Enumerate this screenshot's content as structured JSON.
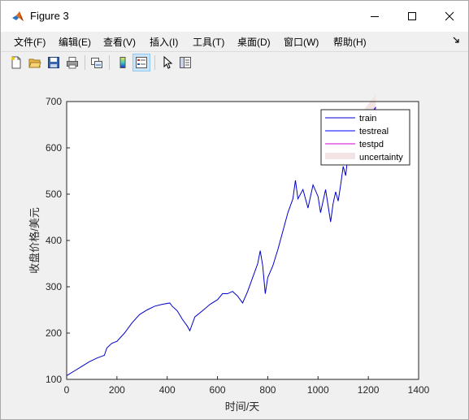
{
  "window": {
    "title": "Figure 3"
  },
  "menu": [
    "文件(F)",
    "编辑(E)",
    "查看(V)",
    "插入(I)",
    "工具(T)",
    "桌面(D)",
    "窗口(W)",
    "帮助(H)"
  ],
  "toolbar": {
    "icons": [
      "new-figure-icon",
      "open-file-icon",
      "save-icon",
      "print-icon",
      "link-plot-icon",
      "colorbar-icon",
      "legend-icon",
      "pointer-icon",
      "plot-tools-icon"
    ]
  },
  "colors": {
    "train": "#0000cc",
    "testreal": "#0000ff",
    "testpd": "#cc00cc",
    "uncertainty": "#f2e4e4"
  },
  "chart_data": {
    "type": "line",
    "title": "",
    "xlabel": "时间/天",
    "ylabel": "收盘价格/美元",
    "xlim": [
      0,
      1400
    ],
    "ylim": [
      100,
      700
    ],
    "xticks": [
      "0",
      "200",
      "400",
      "600",
      "800",
      "1000",
      "1200",
      "1400"
    ],
    "yticks": [
      "100",
      "200",
      "300",
      "400",
      "500",
      "600",
      "700"
    ],
    "grid": false,
    "legend_position": "top-right",
    "legend": [
      "train",
      "testreal",
      "testpd",
      "uncertainty"
    ],
    "series": [
      {
        "name": "train",
        "x": [
          0,
          30,
          60,
          90,
          120,
          150,
          160,
          180,
          200,
          230,
          260,
          290,
          320,
          350,
          380,
          410,
          420,
          440,
          460,
          480,
          490,
          510,
          540,
          570,
          600,
          620,
          640,
          660,
          680,
          700,
          720,
          740,
          760,
          770,
          780,
          790,
          800,
          820,
          840,
          860,
          880,
          900,
          910,
          920,
          940,
          960,
          980,
          1000,
          1010,
          1030,
          1050,
          1060,
          1070,
          1080,
          1090,
          1100,
          1110,
          1120
        ],
        "y": [
          108,
          118,
          128,
          138,
          146,
          152,
          168,
          178,
          182,
          200,
          222,
          240,
          250,
          258,
          262,
          265,
          258,
          248,
          230,
          215,
          205,
          235,
          248,
          262,
          272,
          285,
          285,
          290,
          280,
          265,
          290,
          320,
          350,
          378,
          345,
          285,
          320,
          345,
          380,
          420,
          460,
          490,
          530,
          490,
          510,
          470,
          520,
          495,
          460,
          510,
          440,
          480,
          505,
          485,
          520,
          560,
          540,
          590
        ]
      },
      {
        "name": "testreal",
        "x": [
          1120,
          1140,
          1160,
          1180,
          1200,
          1215,
          1230
        ],
        "y": [
          590,
          610,
          635,
          650,
          665,
          678,
          688
        ]
      },
      {
        "name": "testpd",
        "x": [
          1120,
          1140,
          1160,
          1180,
          1200,
          1215,
          1230
        ],
        "y": [
          588,
          608,
          630,
          648,
          662,
          675,
          685
        ]
      },
      {
        "name": "uncertainty",
        "x": [
          1120,
          1140,
          1160,
          1180,
          1200,
          1215,
          1230
        ],
        "y_low": [
          555,
          575,
          600,
          615,
          630,
          640,
          650
        ],
        "y_high": [
          620,
          640,
          662,
          680,
          695,
          705,
          715
        ]
      }
    ]
  }
}
